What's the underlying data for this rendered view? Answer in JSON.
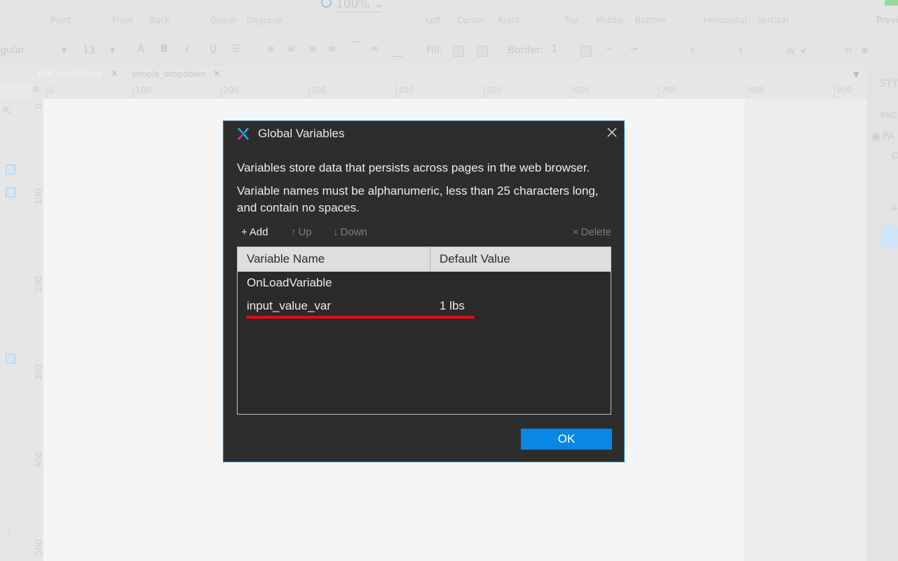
{
  "toolbar": {
    "items_row1": [
      "Point",
      "Front",
      "Back",
      "Group",
      "Ungroup",
      "Left",
      "Center",
      "Right",
      "Top",
      "Middle",
      "Bottom",
      "Horizontal",
      "Vertical"
    ],
    "zoom": "100%",
    "preview_label": "Previ",
    "font_style": "gular",
    "font_size": "13",
    "fill_label": "Fill:",
    "border_label": "Border:",
    "border_value": "1",
    "x_label": "X",
    "y_label": "Y",
    "w_label": "W",
    "h_label": "H"
  },
  "tabs": [
    {
      "label": "edit_combobox",
      "active": true
    },
    {
      "label": "simple_dropdown",
      "active": false
    }
  ],
  "ruler": {
    "h": [
      "0",
      "100",
      "200",
      "300",
      "400",
      "500",
      "600",
      "700",
      "800",
      "900"
    ],
    "v": [
      "0",
      "100",
      "200",
      "300",
      "400",
      "500"
    ]
  },
  "right_panel": {
    "style_tab": "STY",
    "page_label": "PAG",
    "page_item": "PA",
    "item_o": "O"
  },
  "dialog": {
    "title": "Global Variables",
    "description_1": "Variables store data that persists across pages in the web browser.",
    "description_2": "Variable names must be alphanumeric, less than 25 characters long, and contain no spaces.",
    "actions": {
      "add": "Add",
      "up": "Up",
      "down": "Down",
      "delete": "Delete"
    },
    "table": {
      "headers": [
        "Variable Name",
        "Default Value"
      ],
      "rows": [
        {
          "name": "OnLoadVariable",
          "value": ""
        },
        {
          "name": "input_value_var",
          "value": "1 lbs"
        }
      ]
    },
    "ok_label": "OK",
    "colors": {
      "accent": "#0a86e4",
      "dialog_bg": "#2d2d2d",
      "highlight_underline": "#dc0f0f"
    }
  }
}
